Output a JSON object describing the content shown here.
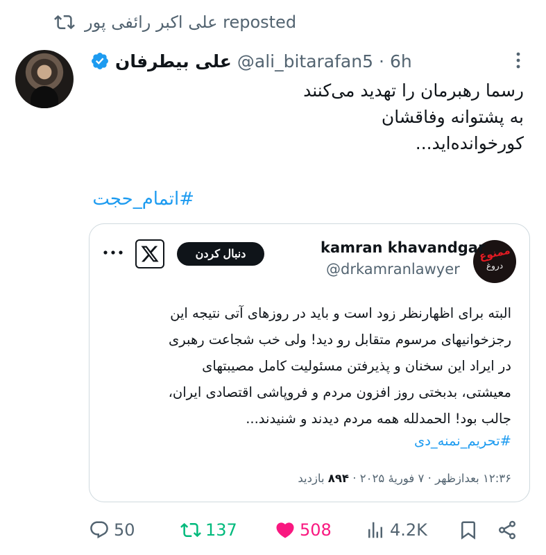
{
  "repost": {
    "text": "علی اکبر رائفی پور reposted",
    "icon": "repost-icon"
  },
  "post": {
    "author_name": "علی بیطرفان",
    "verified_icon": "verified-badge-icon",
    "handle": "@ali_bitarafan5",
    "separator": "·",
    "time": "6h",
    "more_icon": "more-icon",
    "lines": [
      "رسما رهبرمان را تهدید می‌کنند",
      "به پشتوانه وفاقشان",
      "کورخوانده‌اید..."
    ],
    "hashtag": "#اتمام_حجت"
  },
  "quoted": {
    "avatar_text_top": "ممنوع",
    "avatar_text_bottom": "دروغ",
    "author_name": "kamran khavandgar",
    "handle": "@drkamranlawyer",
    "follow_label": "دنبال کردن",
    "lines": [
      "البته برای اظهارنظر زود است و باید در روزهای آتی نتیجه این",
      "رجزخوانیهای مرسوم متقابل رو دید! ولی خب شجاعت رهبری",
      "در ایراد این سخنان و پذیرفتن مسئولیت کامل مصیبتهای",
      "معیشتی، بدبختی روز افزون مردم و فروپاشی اقتصادی ایران،",
      "جالب بود! الحمدلله همه مردم دیدند و شنیدند..."
    ],
    "hashtag": "#تحریم_نمنه_دی",
    "meta_time": "۱۲:۳۶ بعدازظهر · ۷ فوریهٔ ۲۰۲۵ · ",
    "meta_views_count": "۸۹۴",
    "meta_views_label": " بازدید"
  },
  "actions": {
    "replies": "50",
    "reposts": "137",
    "likes": "508",
    "views": "4.2K"
  },
  "colors": {
    "accent": "#1d9bf0",
    "repost_green": "#00ba7c",
    "like_pink": "#f91880",
    "muted": "#536471"
  }
}
